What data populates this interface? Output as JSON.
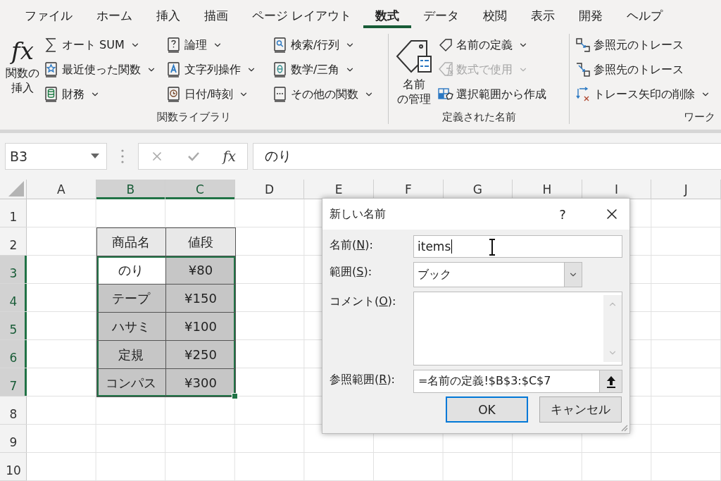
{
  "ribbon_tabs": [
    {
      "label": "ファイル",
      "selected": false
    },
    {
      "label": "ホーム",
      "selected": false
    },
    {
      "label": "挿入",
      "selected": false
    },
    {
      "label": "描画",
      "selected": false
    },
    {
      "label": "ページ レイアウト",
      "selected": false
    },
    {
      "label": "数式",
      "selected": true
    },
    {
      "label": "データ",
      "selected": false
    },
    {
      "label": "校閲",
      "selected": false
    },
    {
      "label": "表示",
      "selected": false
    },
    {
      "label": "開発",
      "selected": false
    },
    {
      "label": "ヘルプ",
      "selected": false
    }
  ],
  "ribbon_groups": [
    {
      "label": "関数ライブラリ",
      "big_button": {
        "symbol": "fx",
        "label_lines": [
          "関数の",
          "挿入"
        ]
      },
      "columns": [
        [
          {
            "label": "オート SUM",
            "dropdown": true,
            "disabled": false
          },
          {
            "label": "最近使った関数",
            "dropdown": true,
            "disabled": false
          },
          {
            "label": "財務",
            "dropdown": true,
            "disabled": false
          }
        ],
        [
          {
            "label": "論理",
            "dropdown": true,
            "disabled": false
          },
          {
            "label": "文字列操作",
            "dropdown": true,
            "disabled": false
          },
          {
            "label": "日付/時刻",
            "dropdown": true,
            "disabled": false
          }
        ],
        [
          {
            "label": "検索/行列",
            "dropdown": true,
            "disabled": false
          },
          {
            "label": "数学/三角",
            "dropdown": true,
            "disabled": false
          },
          {
            "label": "その他の関数",
            "dropdown": true,
            "disabled": false
          }
        ]
      ]
    },
    {
      "label": "定義された名前",
      "big_button": {
        "label_lines": [
          "名前",
          "の管理"
        ]
      },
      "columns": [
        [
          {
            "label": "名前の定義",
            "dropdown": true,
            "disabled": false
          },
          {
            "label": "数式で使用",
            "dropdown": true,
            "disabled": true
          },
          {
            "label": "選択範囲から作成",
            "dropdown": false,
            "disabled": false
          }
        ]
      ]
    },
    {
      "label": "ワーク",
      "columns": [
        [
          {
            "label": "参照元のトレース",
            "dropdown": false,
            "disabled": false
          },
          {
            "label": "参照先のトレース",
            "dropdown": false,
            "disabled": false
          },
          {
            "label": "トレース矢印の削除",
            "dropdown": true,
            "disabled": false
          }
        ]
      ]
    }
  ],
  "formula_bar": {
    "name_box": "B3",
    "function_symbol": "fx",
    "formula": "のり"
  },
  "sheet": {
    "columns": [
      {
        "label": "A",
        "selected": false
      },
      {
        "label": "B",
        "selected": true
      },
      {
        "label": "C",
        "selected": true
      },
      {
        "label": "D",
        "selected": false
      },
      {
        "label": "E",
        "selected": false
      },
      {
        "label": "F",
        "selected": false
      },
      {
        "label": "G",
        "selected": false
      },
      {
        "label": "H",
        "selected": false
      },
      {
        "label": "I",
        "selected": false
      },
      {
        "label": "J",
        "selected": false
      }
    ],
    "rows": [
      {
        "label": "1",
        "selected": false
      },
      {
        "label": "2",
        "selected": false,
        "cells": [
          {
            "text": "商品名",
            "kind": "header",
            "selected": false,
            "active": false
          },
          {
            "text": "値段",
            "kind": "header",
            "selected": false,
            "active": false
          }
        ]
      },
      {
        "label": "3",
        "selected": true,
        "cells": [
          {
            "text": "のり",
            "kind": "data",
            "selected": true,
            "active": true
          },
          {
            "text": "¥80",
            "kind": "data",
            "selected": true,
            "active": false
          }
        ]
      },
      {
        "label": "4",
        "selected": true,
        "cells": [
          {
            "text": "テープ",
            "kind": "data",
            "selected": true,
            "active": false
          },
          {
            "text": "¥150",
            "kind": "data",
            "selected": true,
            "active": false
          }
        ]
      },
      {
        "label": "5",
        "selected": true,
        "cells": [
          {
            "text": "ハサミ",
            "kind": "data",
            "selected": true,
            "active": false
          },
          {
            "text": "¥100",
            "kind": "data",
            "selected": true,
            "active": false
          }
        ]
      },
      {
        "label": "6",
        "selected": true,
        "cells": [
          {
            "text": "定規",
            "kind": "data",
            "selected": true,
            "active": false
          },
          {
            "text": "¥250",
            "kind": "data",
            "selected": true,
            "active": false
          }
        ]
      },
      {
        "label": "7",
        "selected": true,
        "cells": [
          {
            "text": "コンパス",
            "kind": "data",
            "selected": true,
            "active": false
          },
          {
            "text": "¥300",
            "kind": "data",
            "selected": true,
            "active": false
          }
        ]
      },
      {
        "label": "8",
        "selected": false
      },
      {
        "label": "9",
        "selected": false
      },
      {
        "label": "10",
        "selected": false
      }
    ]
  },
  "dialog": {
    "title": "新しい名前",
    "help_symbol": "?",
    "fields": [
      {
        "kind": "text",
        "label": {
          "before": "名前(",
          "key": "N",
          "after": "):"
        },
        "value": "items"
      },
      {
        "kind": "select",
        "label": {
          "before": "範囲(",
          "key": "S",
          "after": "):"
        },
        "value": "ブック"
      },
      {
        "kind": "textarea",
        "label": {
          "before": "コメント(",
          "key": "O",
          "after": "):"
        }
      },
      {
        "kind": "reference",
        "label": {
          "before": "参照範囲(",
          "key": "R",
          "after": "):"
        },
        "value": "=名前の定義!$B$3:$C$7"
      }
    ],
    "buttons": [
      {
        "label": "OK",
        "default": true
      },
      {
        "label": "キャンセル",
        "default": false
      }
    ]
  }
}
